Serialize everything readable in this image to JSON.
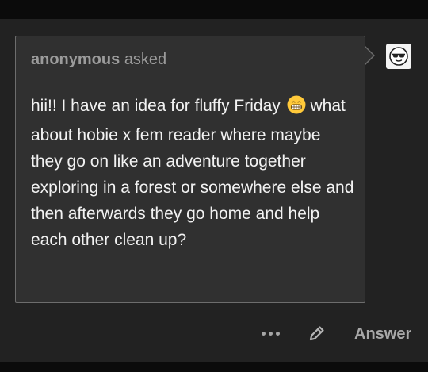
{
  "ask": {
    "asker_name": "anonymous",
    "asked_label": "asked",
    "question": "hii!! I have an idea for fluffy Friday",
    "question_cont": "what about hobie x fem reader where maybe they go on like an adventure together exploring in a forest or somewhere else and then afterwards they go home and help each other clean up?",
    "emoji_icon": "grinning-face-icon",
    "avatar_icon": "sunglasses-face-avatar"
  },
  "actions": {
    "more_icon": "ellipsis-icon",
    "edit_icon": "pencil-icon",
    "answer_label": "Answer"
  },
  "colors": {
    "background": "#222222",
    "bubble": "#303030",
    "bubble_border": "#6d6d6d",
    "text": "#f2f2f2",
    "muted": "#9b9b9b"
  }
}
